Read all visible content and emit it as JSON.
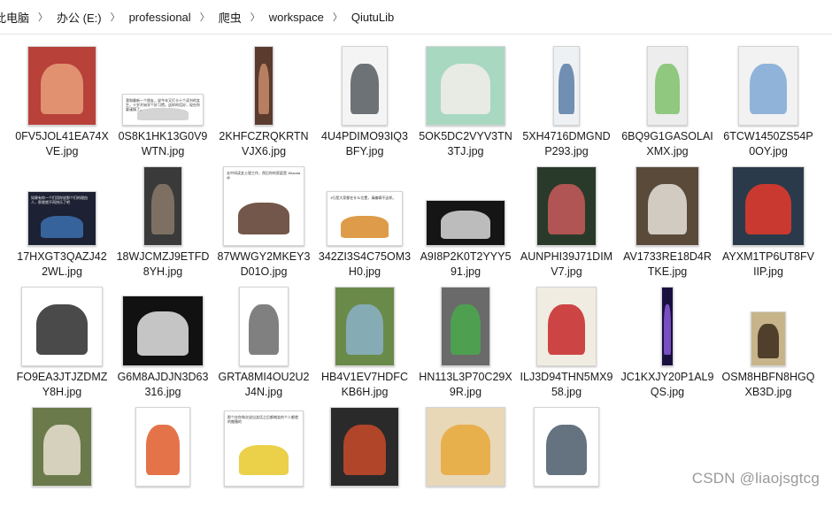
{
  "breadcrumb": [
    "此电脑",
    "办公 (E:)",
    "professional",
    "爬虫",
    "workspace",
    "QiutuLib"
  ],
  "watermark": "CSDN @liaojsgtcg",
  "files": [
    {
      "name": "0FV5JOL41EA74XVE.jpg",
      "thumb_color": "#b8413a",
      "thumb_accent": "#e8a07a",
      "thumb_text": ""
    },
    {
      "name": "0S8K1HK13G0V9WTN.jpg",
      "thumb_color": "#ffffff",
      "thumb_accent": "#cccccc",
      "thumb_text": "我和最新一个朋友，说今年又打卡十个读书的女生，十岁开始学个好习惯。这样的话好，现在你要谨慎了。"
    },
    {
      "name": "2KHFCZRQKRTNVJX6.jpg",
      "thumb_color": "#5a3b2e",
      "thumb_accent": "#c98b6a",
      "thumb_text": ""
    },
    {
      "name": "4U4PDIMO93IQ3BFY.jpg",
      "thumb_color": "#f4f4f4",
      "thumb_accent": "#555a60",
      "thumb_text": ""
    },
    {
      "name": "5OK5DC2VYV3TN3TJ.jpg",
      "thumb_color": "#a8d8c0",
      "thumb_accent": "#f2efe9",
      "thumb_text": ""
    },
    {
      "name": "5XH4716DMGNDP293.jpg",
      "thumb_color": "#eef1f4",
      "thumb_accent": "#5a7ea6",
      "thumb_text": ""
    },
    {
      "name": "6BQ9G1GASOLAIXMX.jpg",
      "thumb_color": "#ededed",
      "thumb_accent": "#7ec16a",
      "thumb_text": ""
    },
    {
      "name": "6TCW1450ZS54P0OY.jpg",
      "thumb_color": "#f2f2f2",
      "thumb_accent": "#7fa8d6",
      "thumb_text": ""
    },
    {
      "name": "17HXGT3QAZJ422WL.jpg",
      "thumb_color": "#1c2233",
      "thumb_accent": "#3c6fb0",
      "thumb_text": "如果有你一个们用你说那个们的理由人，那就就不再快乐了吧"
    },
    {
      "name": "18WJCMZJ9ETFD8YH.jpg",
      "thumb_color": "#3a3a3a",
      "thumb_accent": "#8a7a6a",
      "thumb_text": ""
    },
    {
      "name": "87WWGY2MKEY3D01O.jpg",
      "thumb_color": "#ffffff",
      "thumb_accent": "#5a3a2a",
      "thumb_text": "去中间读女士银工作，然后你的家庭是 Jihaoda@"
    },
    {
      "name": "342ZI3S4C75OM3H0.jpg",
      "thumb_color": "#ffffff",
      "thumb_accent": "#d88a2a",
      "thumb_text": "1行是大家都在什么位置，请编辑不这样。"
    },
    {
      "name": "A9I8P2K0T2YYY591.jpg",
      "thumb_color": "#151515",
      "thumb_accent": "#d9d9d9",
      "thumb_text": ""
    },
    {
      "name": "AUNPHI39J71DIMV7.jpg",
      "thumb_color": "#2a3a2a",
      "thumb_accent": "#c85a5a",
      "thumb_text": ""
    },
    {
      "name": "AV1733RE18D4RTKE.jpg",
      "thumb_color": "#5a4a3a",
      "thumb_accent": "#e7e2da",
      "thumb_text": ""
    },
    {
      "name": "AYXM1TP6UT8FVIIP.jpg",
      "thumb_color": "#2a3a4a",
      "thumb_accent": "#e63a2a",
      "thumb_text": ""
    },
    {
      "name": "FO9EA3JTJZDMZY8H.jpg",
      "thumb_color": "#ffffff",
      "thumb_accent": "#2a2a2a",
      "thumb_text": ""
    },
    {
      "name": "G6M8AJDJN3D63316.jpg",
      "thumb_color": "#111111",
      "thumb_accent": "#e5e5e5",
      "thumb_text": ""
    },
    {
      "name": "GRTA8MI4OU2U2J4N.jpg",
      "thumb_color": "#ffffff",
      "thumb_accent": "#6a6a6a",
      "thumb_text": ""
    },
    {
      "name": "HB4V1EV7HDFCKB6H.jpg",
      "thumb_color": "#6a8a4a",
      "thumb_accent": "#8ab0c8",
      "thumb_text": ""
    },
    {
      "name": "HN113L3P70C29X9R.jpg",
      "thumb_color": "#6a6a6a",
      "thumb_accent": "#49a84b",
      "thumb_text": ""
    },
    {
      "name": "ILJ3D94THN5MX958.jpg",
      "thumb_color": "#f0ece2",
      "thumb_accent": "#c62828",
      "thumb_text": ""
    },
    {
      "name": "JC1KXJY20P1AL9QS.jpg",
      "thumb_color": "#1a1040",
      "thumb_accent": "#8a5ad8",
      "thumb_text": ""
    },
    {
      "name": "OSM8HBFN8HGQXB3D.jpg",
      "thumb_color": "#c8b48a",
      "thumb_accent": "#3a2a1a",
      "thumb_text": ""
    },
    {
      "name": "",
      "thumb_color": "#6a7a4a",
      "thumb_accent": "#e8e0d0",
      "thumb_text": ""
    },
    {
      "name": "",
      "thumb_color": "#ffffff",
      "thumb_accent": "#e05a2a",
      "thumb_text": ""
    },
    {
      "name": "",
      "thumb_color": "#ffffff",
      "thumb_accent": "#e8c82a",
      "thumb_text": "那个在你和次说出笑话之后都摊笑的个人都就的搬撤的"
    },
    {
      "name": "",
      "thumb_color": "#2a2a2a",
      "thumb_accent": "#c84a2a",
      "thumb_text": ""
    },
    {
      "name": "",
      "thumb_color": "#e8d8b8",
      "thumb_accent": "#e8a83a",
      "thumb_text": ""
    },
    {
      "name": "",
      "thumb_color": "#ffffff",
      "thumb_accent": "#4a5a6a",
      "thumb_text": ""
    }
  ]
}
